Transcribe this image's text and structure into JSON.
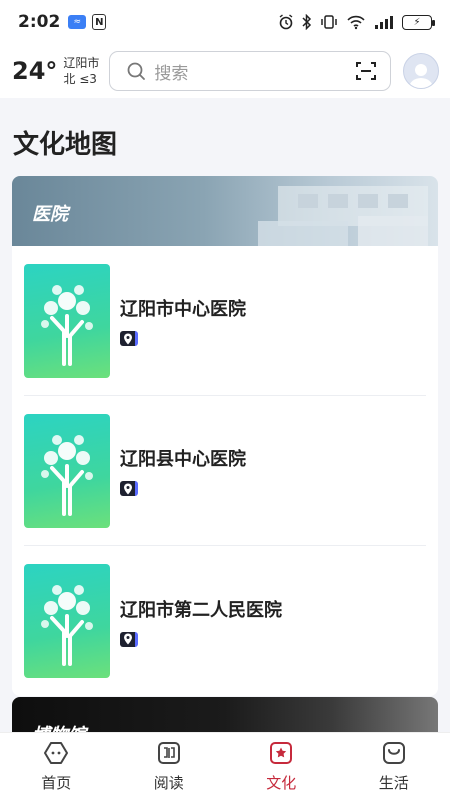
{
  "status_bar": {
    "time": "2:02",
    "app_badge": "≈",
    "nfc": "N",
    "battery": "⚡"
  },
  "header": {
    "temperature": "24°",
    "city": "辽阳市",
    "wind": "北 ≤3",
    "search_placeholder": "搜索"
  },
  "page": {
    "title": "文化地图"
  },
  "category": {
    "label": "医院",
    "items": [
      {
        "name": "辽阳市中心医院"
      },
      {
        "name": "辽阳县中心医院"
      },
      {
        "name": "辽阳市第二人民医院"
      }
    ]
  },
  "next_category": {
    "label": "博物馆"
  },
  "bottom_nav": {
    "items": [
      {
        "label": "首页",
        "icon": "home-icon"
      },
      {
        "label": "阅读",
        "icon": "book-icon"
      },
      {
        "label": "文化",
        "icon": "culture-icon"
      },
      {
        "label": "生活",
        "icon": "life-icon"
      }
    ],
    "active_color": "#c62a3c"
  }
}
